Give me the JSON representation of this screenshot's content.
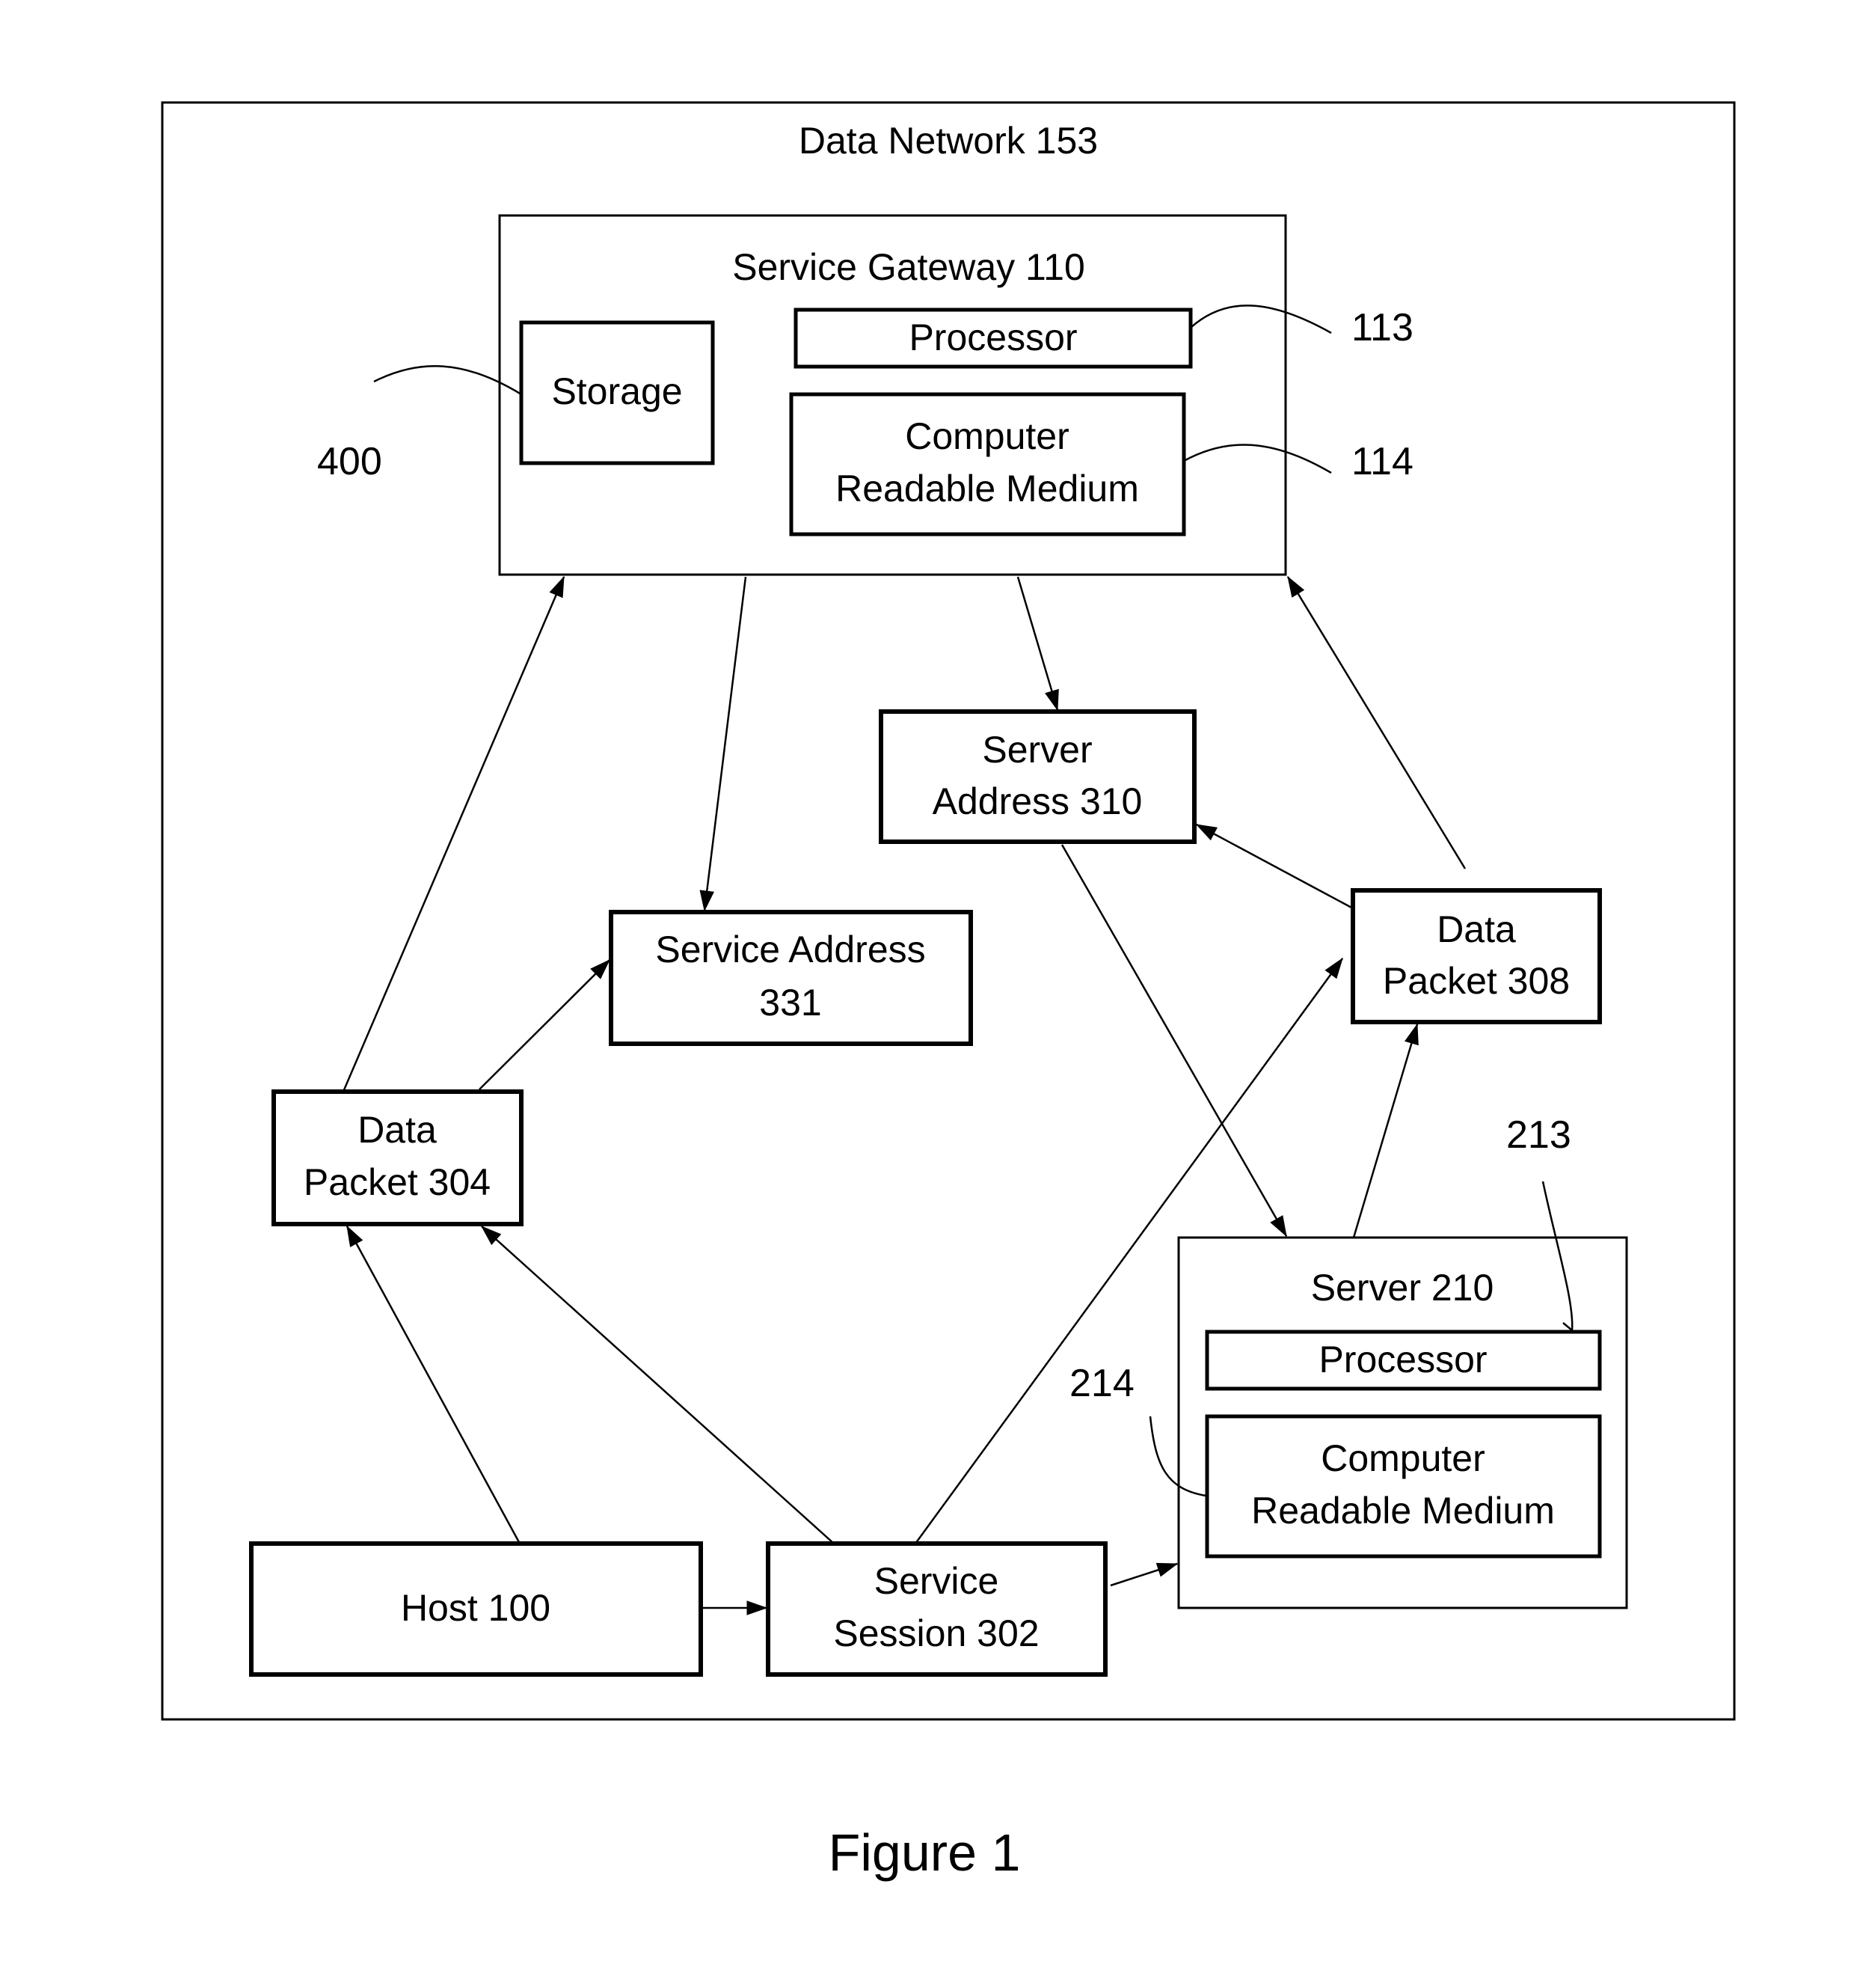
{
  "figure": {
    "caption": "Figure 1",
    "colors": {
      "line": "#000000",
      "background": "#ffffff"
    }
  },
  "network": {
    "label": "Data Network 153"
  },
  "gateway": {
    "label": "Service Gateway 110",
    "storage": "Storage",
    "processor": "Processor",
    "crm_line1": "Computer",
    "crm_line2": "Readable Medium",
    "ref_processor": "113",
    "ref_crm": "114",
    "ref_storage": "400"
  },
  "server_address": {
    "line1": "Server",
    "line2": "Address 310"
  },
  "service_address": {
    "line1": "Service Address",
    "line2": "331"
  },
  "data_packet_308": {
    "line1": "Data",
    "line2": "Packet 308"
  },
  "data_packet_304": {
    "line1": "Data",
    "line2": "Packet 304"
  },
  "server": {
    "label": "Server 210",
    "processor": "Processor",
    "crm_line1": "Computer",
    "crm_line2": "Readable Medium",
    "ref_processor": "213",
    "ref_crm": "214"
  },
  "host": {
    "label": "Host 100"
  },
  "service_session": {
    "line1": "Service",
    "line2": "Session 302"
  },
  "connections": [
    {
      "from": "data-packet-304",
      "to": "service-gateway-110"
    },
    {
      "from": "data-packet-304",
      "to": "service-address-331"
    },
    {
      "from": "service-gateway-110",
      "to": "service-address-331"
    },
    {
      "from": "service-gateway-110",
      "to": "server-address-310"
    },
    {
      "from": "data-packet-308",
      "to": "server-address-310"
    },
    {
      "from": "data-packet-308",
      "to": "service-gateway-110"
    },
    {
      "from": "server-address-310",
      "to": "server-210"
    },
    {
      "from": "server-210",
      "to": "data-packet-308"
    },
    {
      "from": "host-100",
      "to": "data-packet-304"
    },
    {
      "from": "service-session-302",
      "to": "data-packet-304"
    },
    {
      "from": "service-session-302",
      "to": "data-packet-308"
    },
    {
      "from": "host-100",
      "to": "service-session-302"
    },
    {
      "from": "service-session-302",
      "to": "server-210"
    }
  ]
}
